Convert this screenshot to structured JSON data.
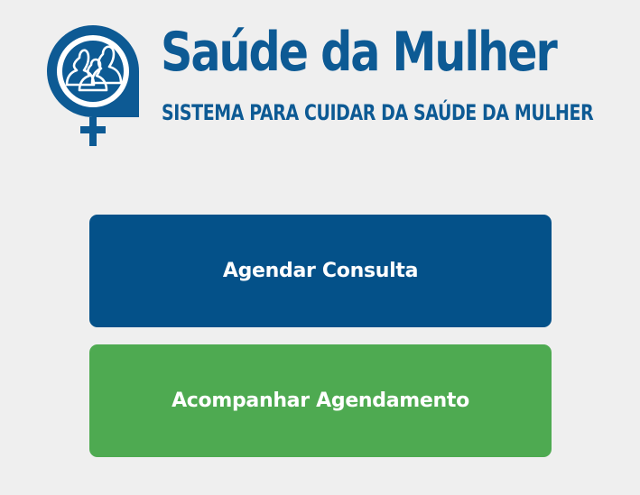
{
  "logo": {
    "title": "Saúde da Mulher",
    "subtitle": "SISTEMA PARA CUIDAR DA SAÚDE DA MULHER",
    "brand_color": "#0d5a94",
    "emblem_icon": "women-venus-symbol-icon"
  },
  "actions": {
    "schedule_label": "Agendar Consulta",
    "schedule_color": "#045189",
    "track_label": "Acompanhar Agendamento",
    "track_color": "#4eaa51"
  },
  "background_color": "#efefef"
}
